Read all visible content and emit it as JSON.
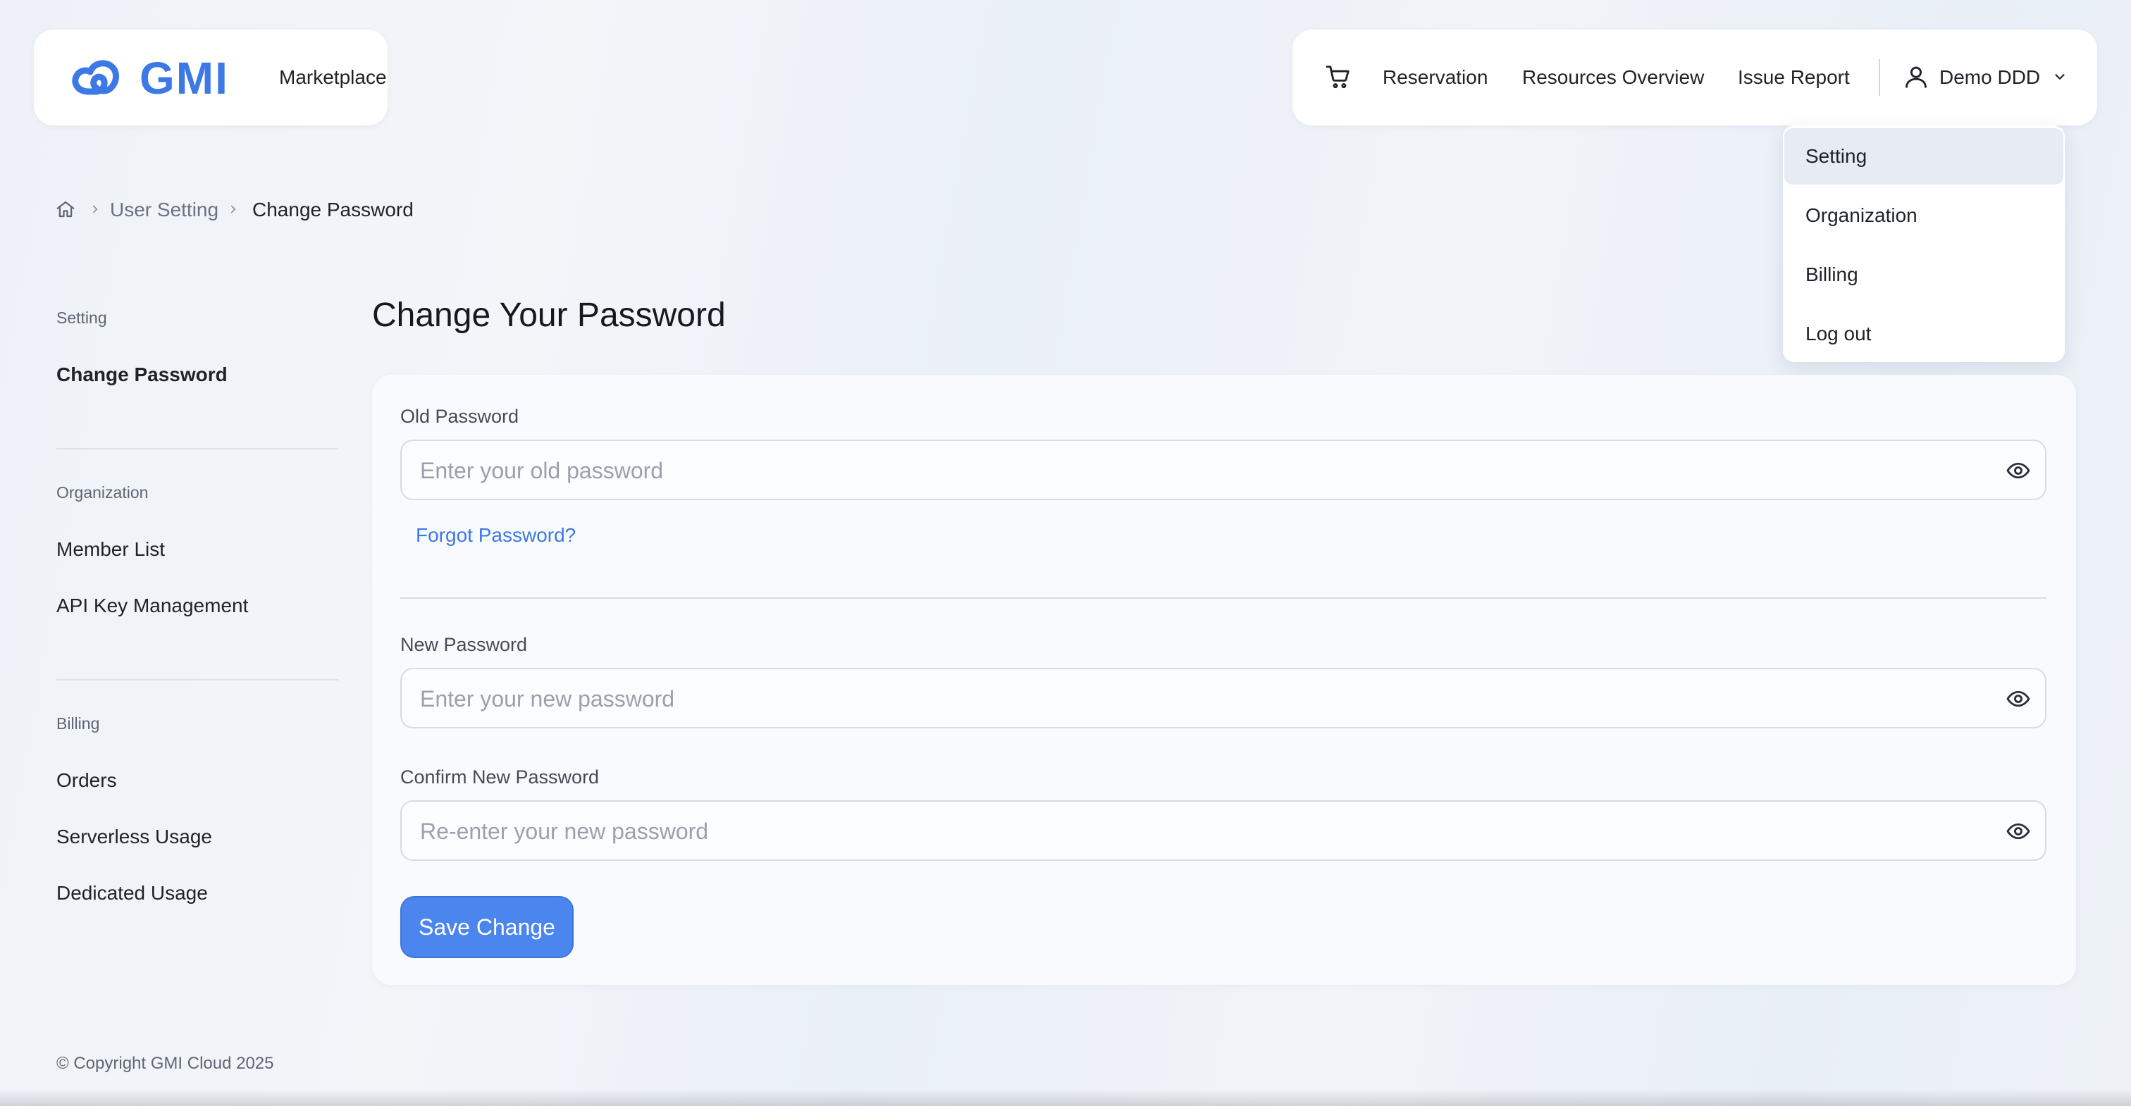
{
  "brand": {
    "logo_text": "GMI",
    "label": "Marketplace",
    "logo_color": "#3c78e6"
  },
  "nav": {
    "cart_icon": "cart-icon",
    "reservation": "Reservation",
    "resources_overview": "Resources Overview",
    "issue_report": "Issue Report",
    "user_name": "Demo DDD",
    "user_icon": "user-icon",
    "chevron_icon": "chevron-down-icon"
  },
  "dropdown": {
    "items": [
      {
        "label": "Setting",
        "active": true
      },
      {
        "label": "Organization",
        "active": false
      },
      {
        "label": "Billing",
        "active": false
      },
      {
        "label": "Log out",
        "active": false
      }
    ]
  },
  "breadcrumb": {
    "home_icon": "home-icon",
    "items": [
      "User Setting",
      "Change Password"
    ]
  },
  "sidebar": {
    "groups": [
      {
        "title": "Setting",
        "items": [
          {
            "label": "Change Password",
            "active": true
          }
        ]
      },
      {
        "title": "Organization",
        "items": [
          {
            "label": "Member List",
            "active": false
          },
          {
            "label": "API Key Management",
            "active": false
          }
        ]
      },
      {
        "title": "Billing",
        "items": [
          {
            "label": "Orders",
            "active": false
          },
          {
            "label": "Serverless Usage",
            "active": false
          },
          {
            "label": "Dedicated Usage",
            "active": false
          }
        ]
      }
    ]
  },
  "main": {
    "title": "Change Your Password",
    "old_password": {
      "label": "Old Password",
      "placeholder": "Enter your old password",
      "value": ""
    },
    "forgot_link": "Forgot Password?",
    "new_password": {
      "label": "New Password",
      "placeholder": "Enter your new password",
      "value": ""
    },
    "confirm_password": {
      "label": "Confirm New Password",
      "placeholder": "Re-enter your new password",
      "value": ""
    },
    "save_label": "Save Change",
    "eye_icon": "eye-icon"
  },
  "footer": {
    "copyright": "© Copyright GMI Cloud 2025"
  },
  "colors": {
    "accent": "#4b85ee",
    "link": "#3c79e8",
    "active_menu_bg": "#e6ebf4"
  }
}
